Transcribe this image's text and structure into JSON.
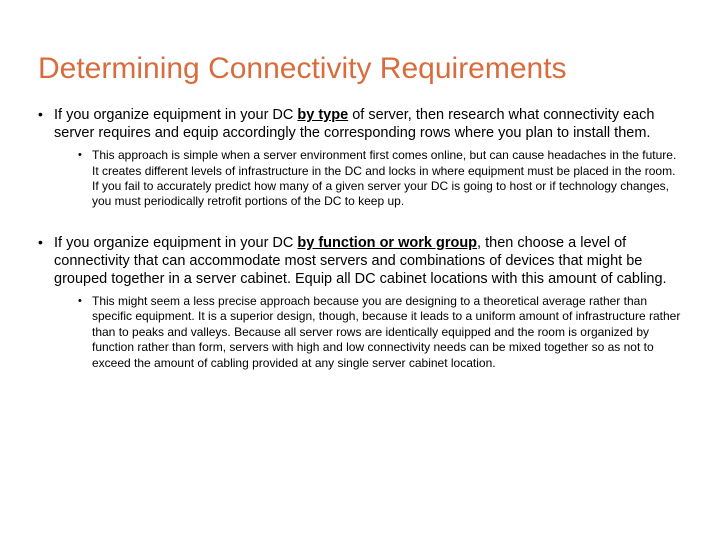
{
  "title": "Determining Connectivity Requirements",
  "bullets": [
    {
      "pre": "If you organize equipment in your DC ",
      "emph": "by type",
      "post": " of server, then research what connectivity each server requires and equip accordingly the corresponding rows where you plan to install them.",
      "sub": "This approach is simple when a server environment first comes online, but can cause headaches in the future. It creates different levels of infrastructure in the DC and locks in where equipment must be placed in the room. If you fail to accurately predict how many of a given server your DC is going to host or if technology changes, you must periodically retrofit portions of the DC to keep up."
    },
    {
      "pre": "If you organize equipment in your DC ",
      "emph": "by function or work group",
      "post": ", then choose a level of connectivity that can accommodate most servers and combinations of devices that might be grouped together in a server cabinet. Equip all DC cabinet locations with this amount of cabling.",
      "sub": "This might seem a less precise approach because you are designing to a theoretical average rather than specific equipment. It is a superior design, though, because it leads to a uniform amount of infrastructure rather than to peaks and valleys. Because all server rows are identically equipped and the room is organized by function rather than form, servers with high and low connectivity needs can be mixed together so as not to exceed the amount of cabling provided at any single server cabinet location."
    }
  ]
}
